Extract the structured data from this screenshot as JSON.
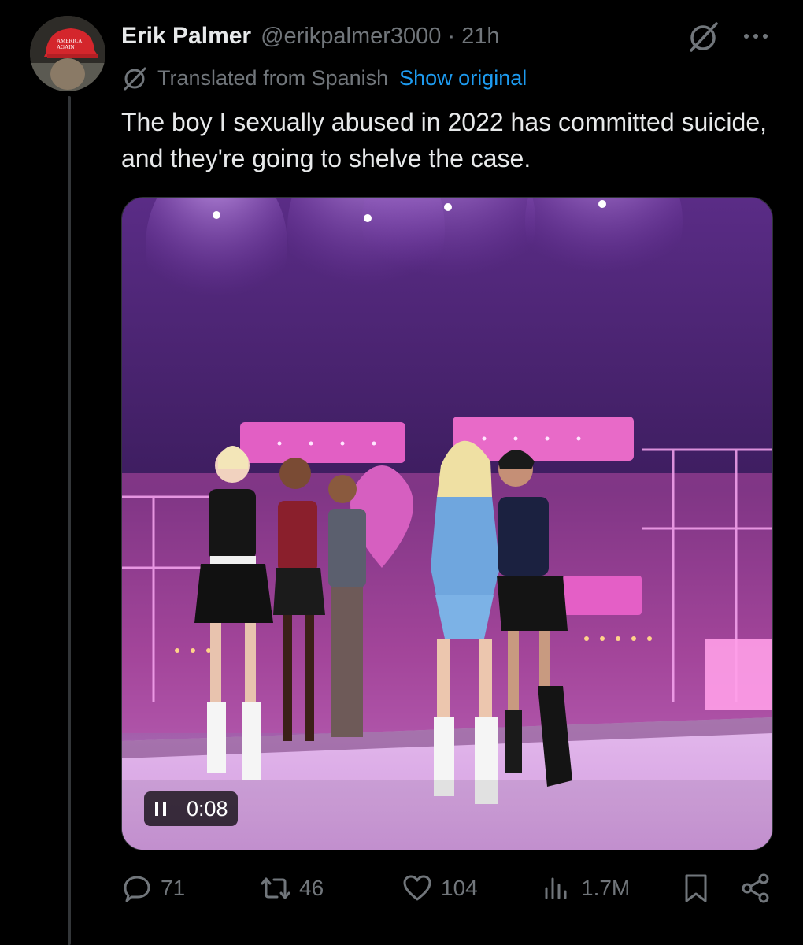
{
  "post": {
    "author_name": "Erik Palmer",
    "author_handle": "@erikpalmer3000",
    "separator": "·",
    "timestamp": "21h",
    "translation_label": "Translated from Spanish",
    "show_original_label": "Show original",
    "text": "The boy I sexually abused in 2022 has committed suicide, and they're going to shelve the case."
  },
  "video": {
    "elapsed": "0:08",
    "state": "playing"
  },
  "actions": {
    "replies": "71",
    "reposts": "46",
    "likes": "104",
    "views": "1.7M"
  },
  "icons": {
    "grok": "grok-icon",
    "more": "more-dots-icon",
    "translate": "translate-icon",
    "reply": "reply-icon",
    "repost": "repost-icon",
    "like": "heart-icon",
    "views": "views-icon",
    "bookmark": "bookmark-icon",
    "share": "share-icon"
  },
  "colors": {
    "background": "#000000",
    "text_primary": "#e7e9ea",
    "text_secondary": "#71767b",
    "link": "#1d9bf0",
    "thread_line": "#333639"
  }
}
